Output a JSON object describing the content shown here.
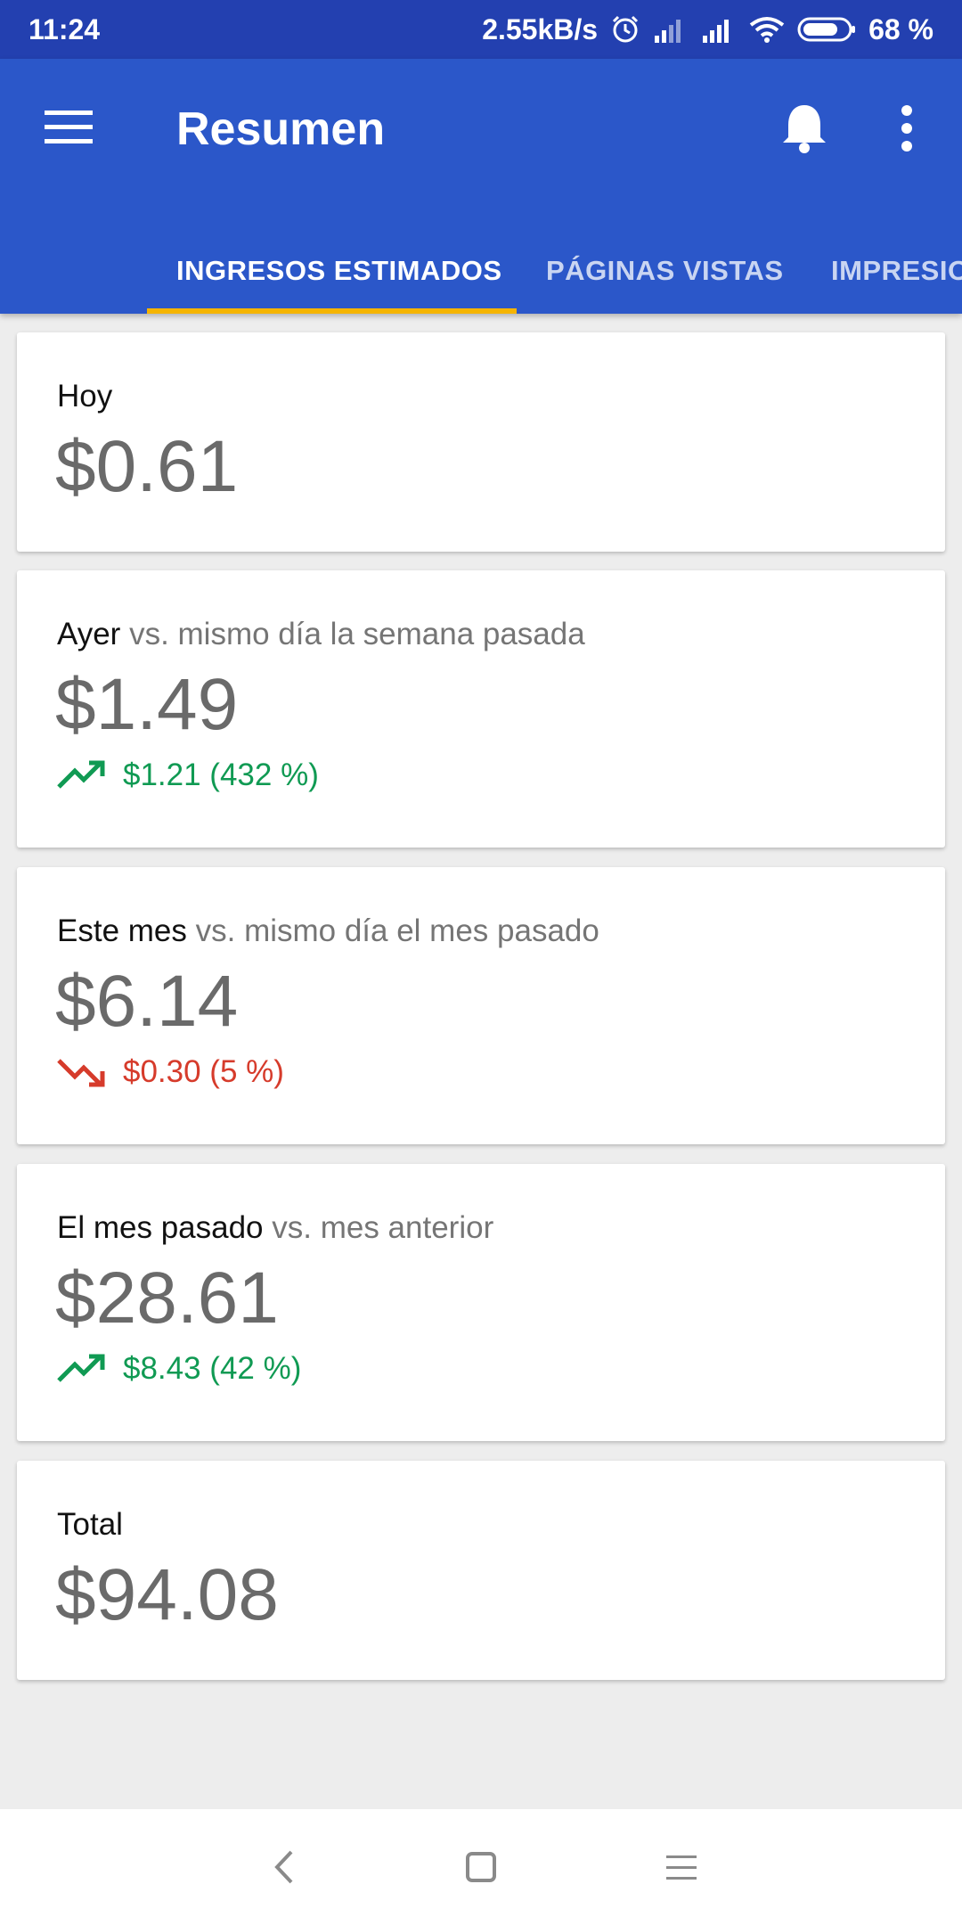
{
  "status_bar": {
    "time": "11:24",
    "network_speed": "2.55kB/s",
    "battery_percent": "68 %",
    "icons": [
      "alarm-icon",
      "signal-icon",
      "signal-icon",
      "wifi-icon",
      "battery-icon"
    ]
  },
  "app_bar": {
    "title": "Resumen",
    "icons": [
      "menu-icon",
      "bell-icon",
      "more-vert-icon"
    ]
  },
  "tabs": [
    {
      "label": "INGRESOS ESTIMADOS",
      "active": true
    },
    {
      "label": "PÁGINAS VISTAS",
      "active": false
    },
    {
      "label": "IMPRESIO",
      "active": false
    }
  ],
  "cards": [
    {
      "label": "Hoy",
      "comparison": "",
      "value": "$0.61"
    },
    {
      "label": "Ayer",
      "comparison": " vs. mismo día la semana pasada",
      "value": "$1.49",
      "change": "$1.21 (432 %)",
      "trend": "up"
    },
    {
      "label": "Este mes",
      "comparison": " vs. mismo día el mes pasado",
      "value": "$6.14",
      "change": "$0.30 (5 %)",
      "trend": "down"
    },
    {
      "label": "El mes pasado",
      "comparison": " vs. mes anterior",
      "value": "$28.61",
      "change": "$8.43 (42 %)",
      "trend": "up"
    },
    {
      "label": "Total",
      "comparison": "",
      "value": "$94.08"
    }
  ],
  "colors": {
    "status_bar": "#2340b0",
    "app_bar": "#2b57c9",
    "tab_indicator": "#f5b400",
    "trend_up": "#109a53",
    "trend_down": "#d63b2b",
    "value_text": "#6a6a6a",
    "background": "#ededed"
  },
  "nav_bar": {
    "icons": [
      "back-icon",
      "home-icon",
      "recents-icon"
    ]
  }
}
